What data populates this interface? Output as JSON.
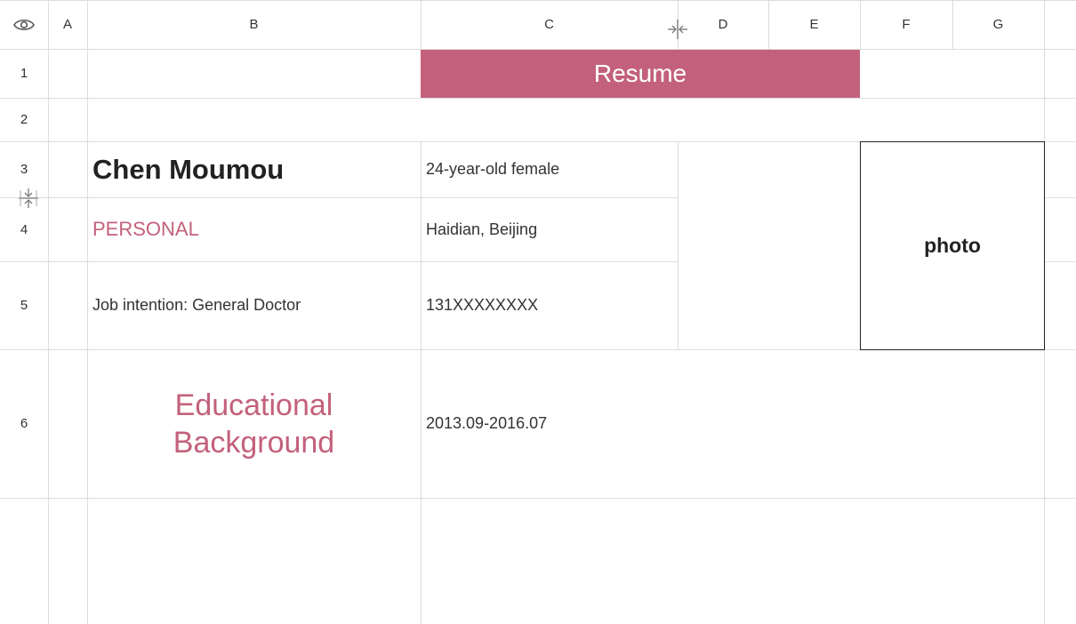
{
  "columns": [
    "A",
    "B",
    "C",
    "D",
    "E",
    "F",
    "G"
  ],
  "rows": [
    "1",
    "2",
    "3",
    "4",
    "5",
    "6"
  ],
  "cells": {
    "c1": "Resume",
    "b3": "Chen Moumou",
    "c3": "24-year-old female",
    "b4": "PERSONAL",
    "c4": "Haidian, Beijing",
    "b5": "Job intention: General Doctor",
    "c5": "131XXXXXXXX",
    "f3": "photo",
    "b6_line1": "Educational",
    "b6_line2": "Background",
    "c6": "2013.09-2016.07"
  },
  "colors": {
    "accent": "#c3617c",
    "grid": "#dcdcdc"
  },
  "icons": {
    "corner": "eye-icon",
    "col_resize": "column-resize-icon",
    "row_resize": "row-resize-icon"
  }
}
